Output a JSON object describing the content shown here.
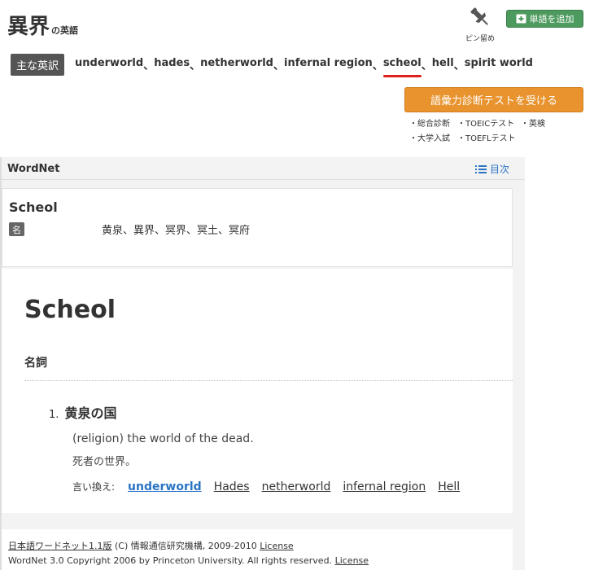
{
  "header": {
    "title": "異界",
    "title_suffix": "の英語",
    "pin_label": "ピン留め",
    "add_word_label": "単語を追加"
  },
  "main_english": {
    "badge": "主な英訳",
    "items": [
      "underworld",
      "hades",
      "netherworld",
      "infernal region",
      "scheol",
      "hell",
      "spirit world"
    ],
    "separator": "、",
    "highlighted_index": 4
  },
  "test": {
    "button_label": "語彙力診断テストを受ける",
    "links": [
      "・総合診断",
      "・TOEICテスト",
      "・英検",
      "・大学入試",
      "・TOEFLテスト"
    ]
  },
  "wordnet": {
    "section_title": "WordNet",
    "toc_label": "目次",
    "summary": {
      "word": "Scheol",
      "pos_badge": "名",
      "synonyms": "黄泉、異界、冥界、冥土、冥府"
    },
    "detail": {
      "headword": "Scheol",
      "pos_heading": "名詞",
      "sense_number": "1.",
      "sense_gloss": "黄泉の国",
      "definition_en": "(religion) the world of the dead.",
      "definition_ja": "死者の世界。",
      "alt_label": "言い換え:",
      "alternatives": [
        "underworld",
        "Hades",
        "netherworld",
        "infernal region",
        "Hell"
      ]
    },
    "footer": {
      "line1_link": "日本語ワードネット1.1版",
      "line1_text": " (C) 情報通信研究機構, 2009-2010 ",
      "line1_license": "License",
      "line2_text": "WordNet 3.0 Copyright 2006 by Princeton University. All rights reserved. ",
      "line2_license": "License"
    }
  },
  "colors": {
    "add_button": "#4c9a5d",
    "test_button": "#e8932e",
    "link_blue": "#2a74c4",
    "highlight_red": "#e0201b",
    "badge_gray": "#555555"
  },
  "icons": [
    "pin-icon",
    "book-plus-icon",
    "list-icon"
  ]
}
